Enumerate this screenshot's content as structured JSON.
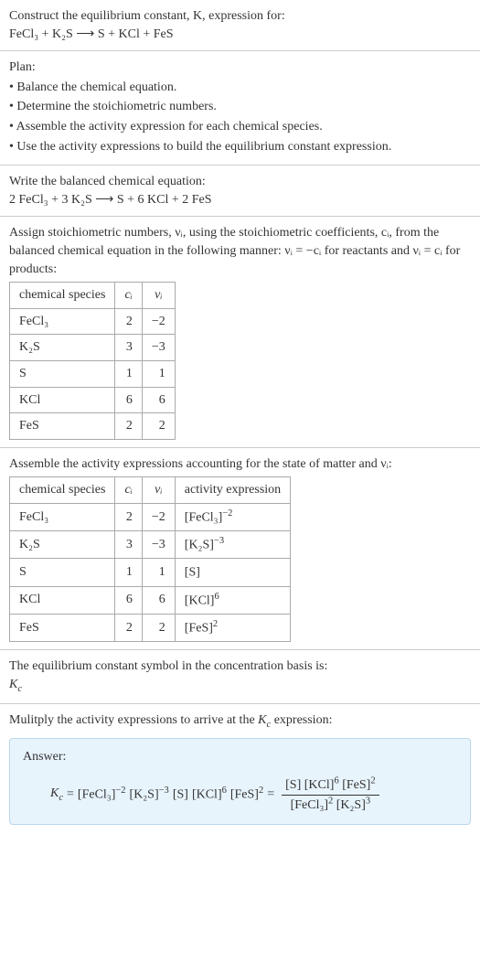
{
  "header": {
    "prompt_line1": "Construct the equilibrium constant, K, expression for:",
    "equation_text": "FeCl₃ + K₂S ⟶ S + KCl + FeS"
  },
  "plan": {
    "title": "Plan:",
    "items": [
      "Balance the chemical equation.",
      "Determine the stoichiometric numbers.",
      "Assemble the activity expression for each chemical species.",
      "Use the activity expressions to build the equilibrium constant expression."
    ]
  },
  "balanced": {
    "title": "Write the balanced chemical equation:",
    "equation_text": "2 FeCl₃ + 3 K₂S ⟶ S + 6 KCl + 2 FeS"
  },
  "stoich": {
    "intro": "Assign stoichiometric numbers, νᵢ, using the stoichiometric coefficients, cᵢ, from the balanced chemical equation in the following manner: νᵢ = −cᵢ for reactants and νᵢ = cᵢ for products:",
    "headers": {
      "species": "chemical species",
      "ci": "cᵢ",
      "vi": "νᵢ"
    },
    "rows": [
      {
        "species": "FeCl₃",
        "ci": "2",
        "vi": "−2"
      },
      {
        "species": "K₂S",
        "ci": "3",
        "vi": "−3"
      },
      {
        "species": "S",
        "ci": "1",
        "vi": "1"
      },
      {
        "species": "KCl",
        "ci": "6",
        "vi": "6"
      },
      {
        "species": "FeS",
        "ci": "2",
        "vi": "2"
      }
    ]
  },
  "activity": {
    "intro": "Assemble the activity expressions accounting for the state of matter and νᵢ:",
    "headers": {
      "species": "chemical species",
      "ci": "cᵢ",
      "vi": "νᵢ",
      "expr": "activity expression"
    },
    "rows": [
      {
        "species": "FeCl₃",
        "ci": "2",
        "vi": "−2",
        "base": "[FeCl₃]",
        "exp": "−2"
      },
      {
        "species": "K₂S",
        "ci": "3",
        "vi": "−3",
        "base": "[K₂S]",
        "exp": "−3"
      },
      {
        "species": "S",
        "ci": "1",
        "vi": "1",
        "base": "[S]",
        "exp": ""
      },
      {
        "species": "KCl",
        "ci": "6",
        "vi": "6",
        "base": "[KCl]",
        "exp": "6"
      },
      {
        "species": "FeS",
        "ci": "2",
        "vi": "2",
        "base": "[FeS]",
        "exp": "2"
      }
    ]
  },
  "kc_symbol": {
    "line1": "The equilibrium constant symbol in the concentration basis is:",
    "symbol": "K_c"
  },
  "multiply": {
    "title": "Mulitply the activity expressions to arrive at the K_c expression:"
  },
  "answer": {
    "label": "Answer:",
    "kc": "K_c",
    "eq1_terms": [
      {
        "base": "[FeCl₃]",
        "exp": "−2"
      },
      {
        "base": "[K₂S]",
        "exp": "−3"
      },
      {
        "base": "[S]",
        "exp": ""
      },
      {
        "base": "[KCl]",
        "exp": "6"
      },
      {
        "base": "[FeS]",
        "exp": "2"
      }
    ],
    "frac_num": [
      {
        "base": "[S]",
        "exp": ""
      },
      {
        "base": "[KCl]",
        "exp": "6"
      },
      {
        "base": "[FeS]",
        "exp": "2"
      }
    ],
    "frac_den": [
      {
        "base": "[FeCl₃]",
        "exp": "2"
      },
      {
        "base": "[K₂S]",
        "exp": "3"
      }
    ]
  },
  "equals": "="
}
